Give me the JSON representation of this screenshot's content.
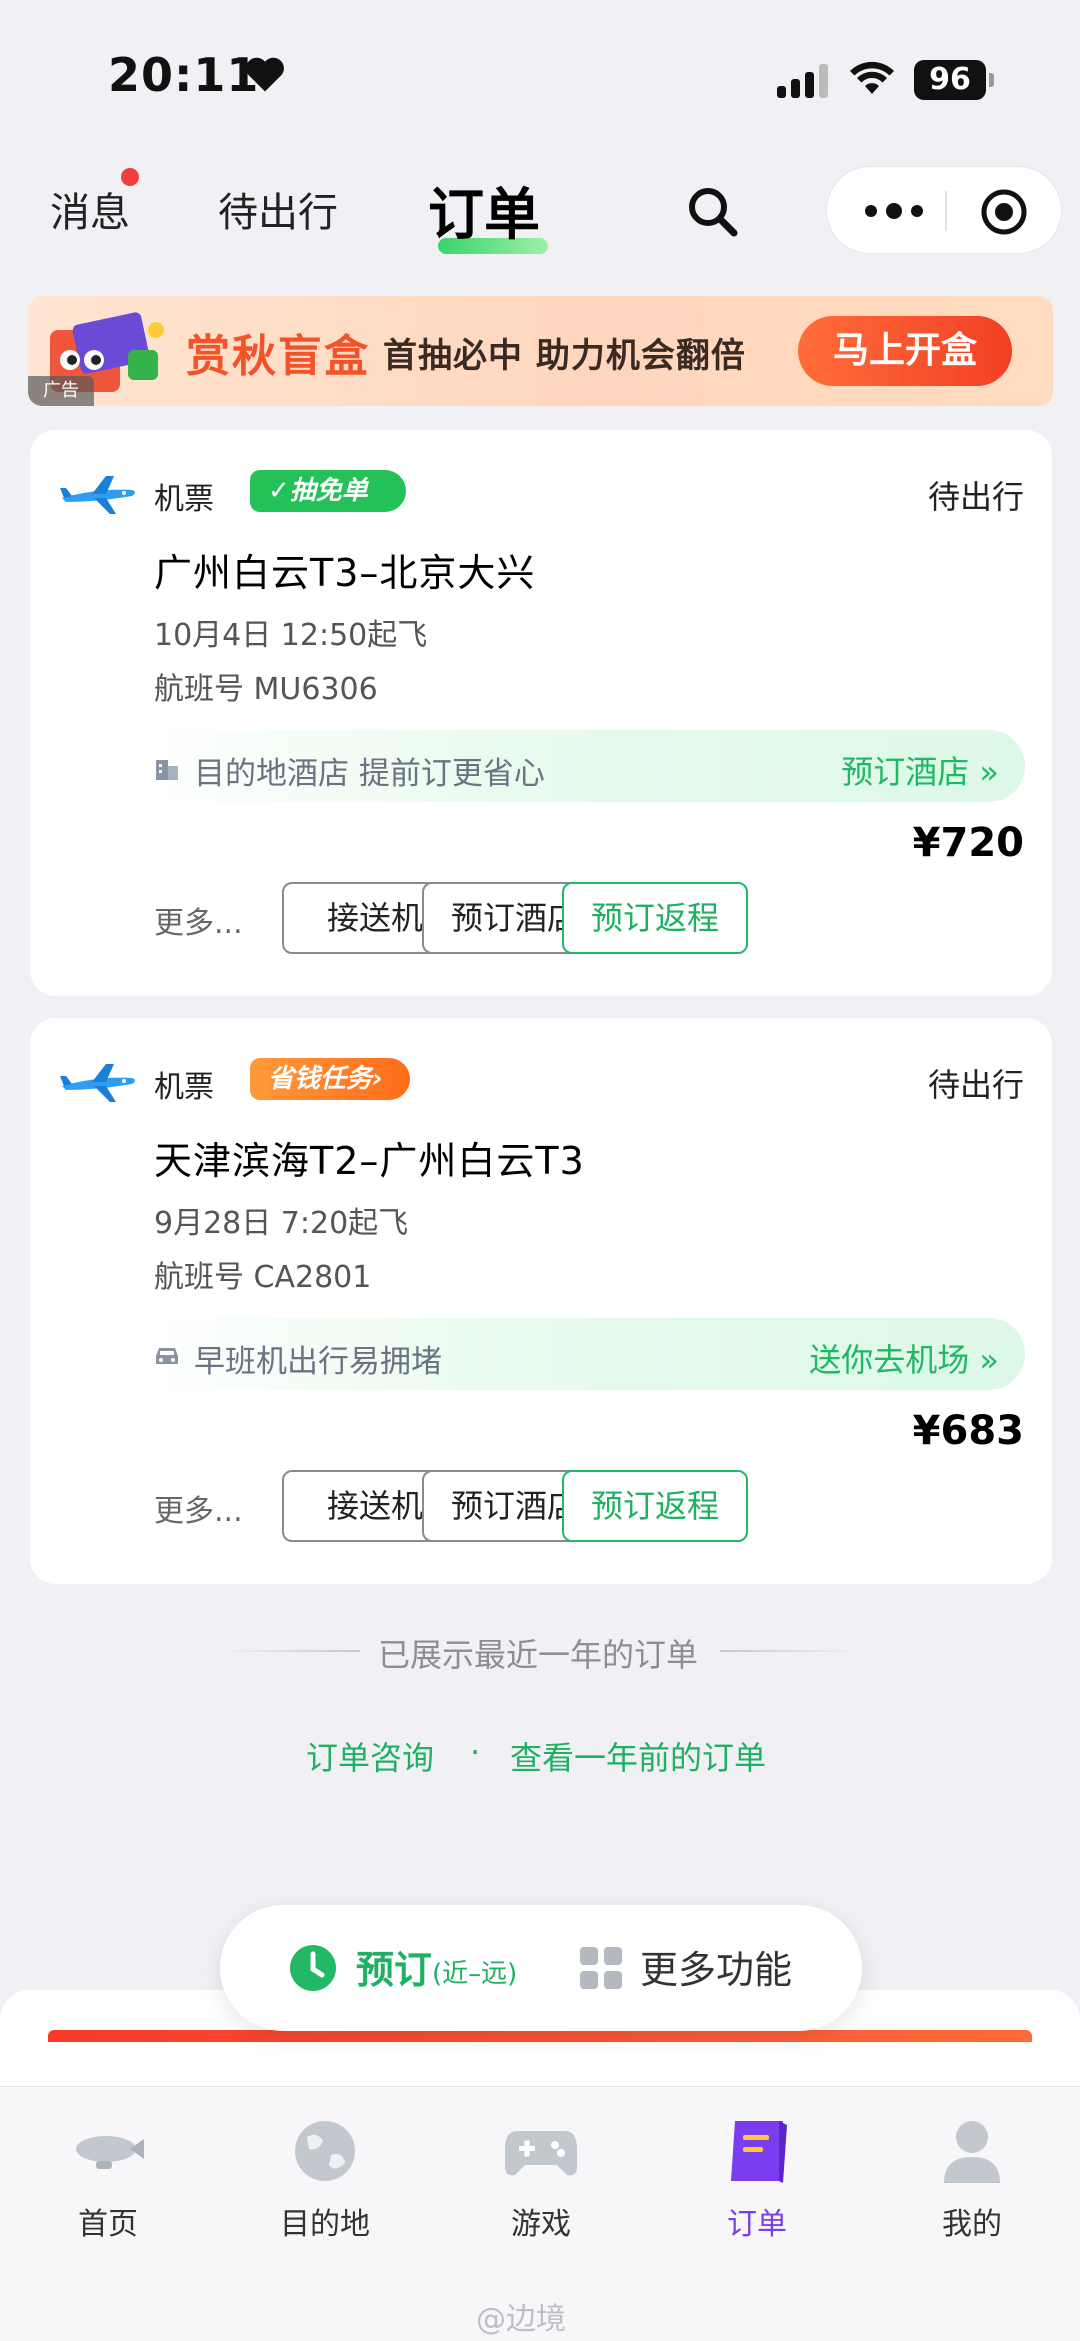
{
  "status_bar": {
    "time": "20:11",
    "battery": "96"
  },
  "header": {
    "tabs": [
      {
        "label": "消息",
        "has_dot": true
      },
      {
        "label": "待出行"
      },
      {
        "label": "订单",
        "active": true
      }
    ]
  },
  "ad": {
    "tag": "广告",
    "title": "赏秋盲盒",
    "subtitle": "首抽必中 助力机会翻倍",
    "button": "马上开盒"
  },
  "orders": [
    {
      "category": "机票",
      "badge": "✓抽免单",
      "state": "待出行",
      "route": "广州白云T3–北京大兴",
      "departure": "10月4日 12:50起飞",
      "flight_no": "航班号 MU6306",
      "promo_text": "目的地酒店 提前订更省心",
      "promo_link": "预订酒店 »",
      "price": "¥720",
      "more": "更多...",
      "buttons": [
        "接送机",
        "预订酒店",
        "预订返程"
      ]
    },
    {
      "category": "机票",
      "badge": "省钱任务›",
      "state": "待出行",
      "route": "天津滨海T2–广州白云T3",
      "departure": "9月28日 7:20起飞",
      "flight_no": "航班号 CA2801",
      "promo_text": "早班机出行易拥堵",
      "promo_link": "送你去机场 »",
      "price": "¥683",
      "more": "更多...",
      "buttons": [
        "接送机",
        "预订酒店",
        "预订返程"
      ]
    }
  ],
  "footer": {
    "shown_text": "已展示最近一年的订单",
    "link_consult": "订单咨询",
    "link_dot": "·",
    "link_older": "查看一年前的订单"
  },
  "floating_pill": {
    "book": "预订",
    "range": "(近–远)",
    "more": "更多功能"
  },
  "bottom_nav": [
    {
      "label": "首页",
      "icon": "blimp-icon"
    },
    {
      "label": "目的地",
      "icon": "globe-icon"
    },
    {
      "label": "游戏",
      "icon": "gamepad-icon"
    },
    {
      "label": "订单",
      "icon": "order-book-icon",
      "active": true
    },
    {
      "label": "我的",
      "icon": "person-icon"
    }
  ],
  "watermark": "@边境",
  "colors": {
    "accent_green": "#1fb062",
    "active_purple": "#7a3df0",
    "ad_orange": "#f4532a"
  }
}
